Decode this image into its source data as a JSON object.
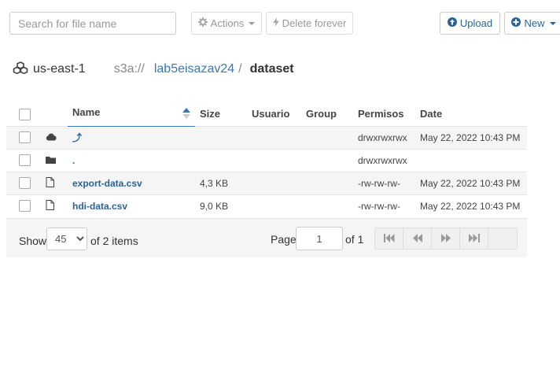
{
  "toolbar": {
    "search_placeholder": "Search for file name",
    "actions_label": "Actions",
    "delete_label": "Delete forever",
    "upload_label": "Upload",
    "new_label": "New"
  },
  "breadcrumb": {
    "region": "us-east-1",
    "scheme": "s3a://",
    "bucket": "lab5eisazav24",
    "separator": "/",
    "folder": "dataset"
  },
  "table": {
    "headers": {
      "name": "Name",
      "size": "Size",
      "user": "Usuario",
      "group": "Group",
      "permissions": "Permisos",
      "date": "Date"
    },
    "rows": [
      {
        "icon": "cloud-icon",
        "name": "⤴",
        "size": "",
        "user": "",
        "group": "",
        "permissions": "drwxrwxrwx",
        "date": "May 22, 2022 10:43 PM"
      },
      {
        "icon": "folder-icon",
        "name": ".",
        "size": "",
        "user": "",
        "group": "",
        "permissions": "drwxrwxrwx",
        "date": ""
      },
      {
        "icon": "file-icon",
        "name": "export-data.csv",
        "size": "4,3 KB",
        "user": "",
        "group": "",
        "permissions": "-rw-rw-rw-",
        "date": "May 22, 2022 10:43 PM"
      },
      {
        "icon": "file-icon",
        "name": "hdi-data.csv",
        "size": "9,0 KB",
        "user": "",
        "group": "",
        "permissions": "-rw-rw-rw-",
        "date": "May 22, 2022 10:43 PM"
      }
    ]
  },
  "footer": {
    "show_label": "Show",
    "page_size": "45",
    "page_size_options": [
      "45"
    ],
    "items_label": "of 2 items",
    "page_label": "Page",
    "page_value": "1",
    "of_pages_label": "of 1"
  },
  "colors": {
    "link": "#2a6496",
    "accent": "#337ab7"
  }
}
